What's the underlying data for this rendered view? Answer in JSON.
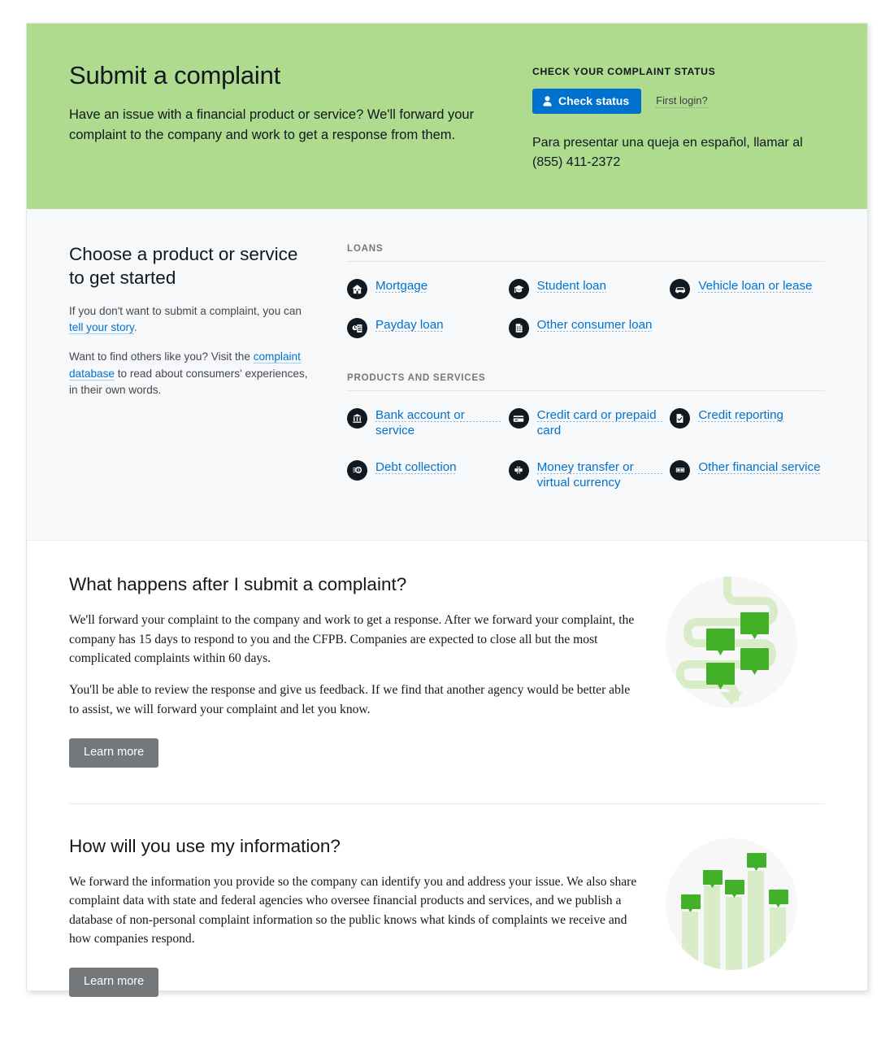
{
  "hero": {
    "title": "Submit a complaint",
    "subtitle": "Have an issue with a financial product or service? We'll forward your complaint to the company and work to get a response from them.",
    "status_kicker": "CHECK YOUR COMPLAINT STATUS",
    "check_status_label": "Check status",
    "first_login_label": "First login?",
    "spanish_note": "Para presentar una queja en español, llamar al (855) 411-2372",
    "background_color": "#aedb8e",
    "button_color": "#0072ce"
  },
  "chooser": {
    "title": "Choose a product or service to get started",
    "para1_before": "If you don't want to submit a complaint, you can ",
    "para1_link": "tell your story",
    "para1_after": ".",
    "para2_before": "Want to find others like you? Visit the ",
    "para2_link": "complaint database",
    "para2_after": " to read about consumers' experiences, in their own words.",
    "groups": [
      {
        "label": "LOANS",
        "items": [
          {
            "label": "Mortgage",
            "icon": "house-icon"
          },
          {
            "label": "Student loan",
            "icon": "graduation-cap-icon"
          },
          {
            "label": "Vehicle loan or lease",
            "icon": "car-icon"
          },
          {
            "label": "Payday loan",
            "icon": "clock-document-icon"
          },
          {
            "label": "Other consumer loan",
            "icon": "document-icon"
          }
        ]
      },
      {
        "label": "PRODUCTS AND SERVICES",
        "items": [
          {
            "label": "Bank account or service",
            "icon": "bank-icon"
          },
          {
            "label": "Credit card or prepaid card",
            "icon": "credit-card-icon"
          },
          {
            "label": "Credit reporting",
            "icon": "checked-document-icon"
          },
          {
            "label": "Debt collection",
            "icon": "coin-hand-icon"
          },
          {
            "label": "Money transfer or virtual currency",
            "icon": "transfer-dollar-icon"
          },
          {
            "label": "Other financial service",
            "icon": "dollar-bill-icon"
          }
        ]
      }
    ]
  },
  "sections": [
    {
      "title": "What happens after I submit a complaint?",
      "paragraphs": [
        "We'll forward your complaint to the company and work to get a response. After we forward your complaint, the company has 15 days to respond to you and the CFPB. Companies are expected to close all but the most complicated complaints within 60 days.",
        "You'll be able to review the response and give us feedback. If we find that another agency would be better able to assist, we will forward your complaint and let you know."
      ],
      "button_label": "Learn more",
      "illustration": "winding-path-with-speech-bubbles-illustration"
    },
    {
      "title": "How will you use my information?",
      "paragraphs": [
        "We forward the information you provide so the company can identify you and address your issue. We also share complaint data with state and federal agencies who oversee financial products and services, and we publish a database of non-personal complaint information so the public knows what kinds of complaints we receive and how companies respond."
      ],
      "button_label": "Learn more",
      "illustration": "bar-chart-with-speech-bubbles-illustration"
    }
  ],
  "colors": {
    "link": "#0072ce",
    "icon_background": "#101820",
    "learn_more_button": "#75787b",
    "illustration_green": "#43b02a",
    "illustration_light_green": "#d9ecc8"
  }
}
